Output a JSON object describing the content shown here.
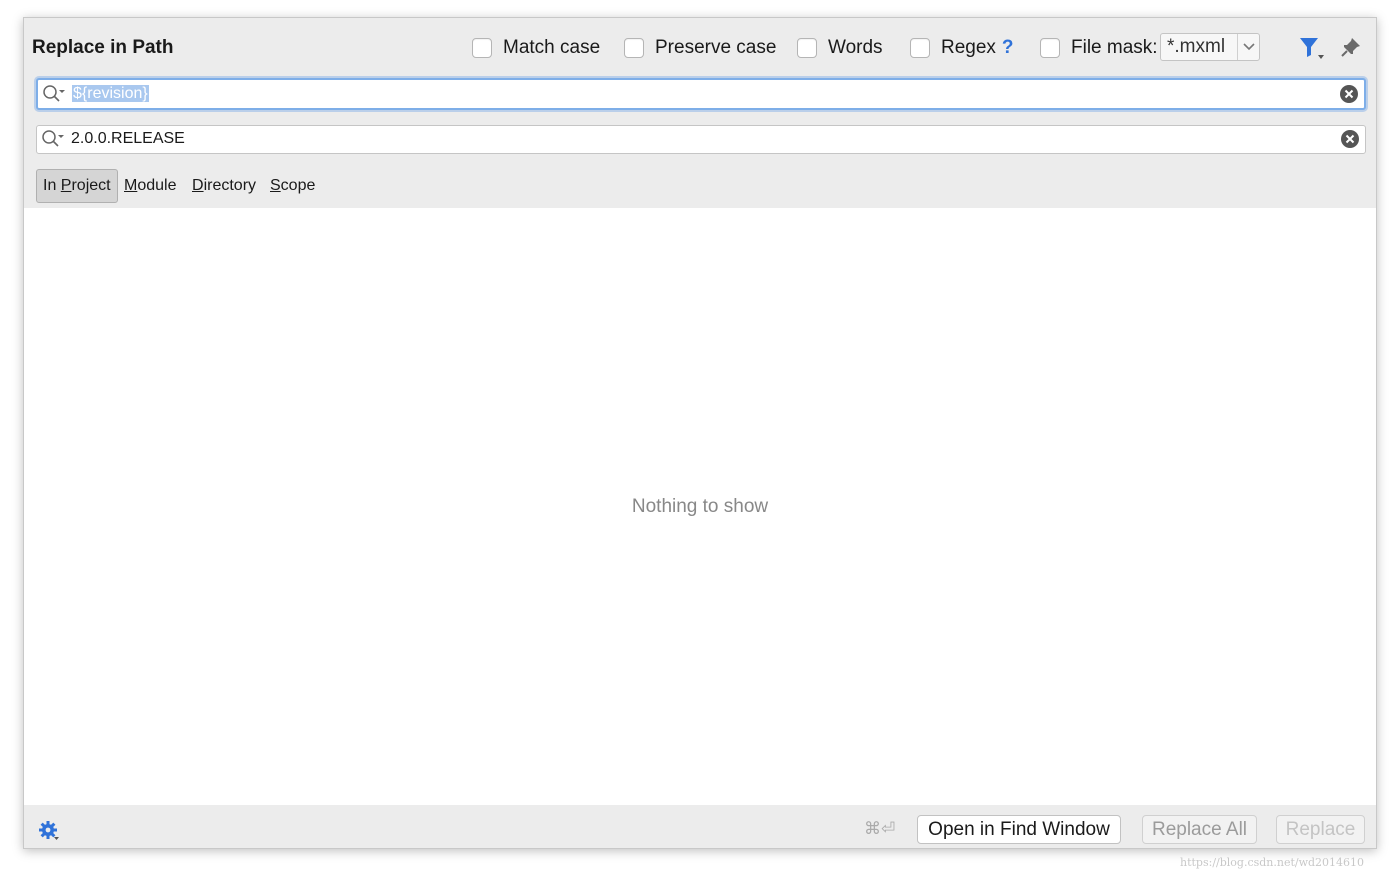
{
  "dialog": {
    "title": "Replace in Path"
  },
  "options": {
    "match_case": {
      "label": "Match case",
      "checked": false
    },
    "preserve_case": {
      "label": "Preserve case",
      "checked": false
    },
    "words": {
      "label": "Words",
      "checked": false
    },
    "regex": {
      "label": "Regex",
      "help": "?",
      "checked": false
    },
    "file_mask": {
      "label": "File mask:",
      "checked": false,
      "value": "*.mxml"
    }
  },
  "search": {
    "find_value": "${revision}",
    "replace_value": "2.0.0.RELEASE"
  },
  "scope_tabs": {
    "in_project_pre": "In ",
    "in_project_u": "P",
    "in_project_post": "roject",
    "module_u": "M",
    "module_post": "odule",
    "directory_u": "D",
    "directory_post": "irectory",
    "scope_u": "S",
    "scope_post": "cope",
    "active": "In Project"
  },
  "results": {
    "empty_text": "Nothing to show"
  },
  "footer": {
    "shortcut": "⌘⏎",
    "open_in_find_window": "Open in Find Window",
    "replace_all": "Replace All",
    "replace": "Replace"
  },
  "watermark": "https://blog.csdn.net/wd2014610",
  "colors": {
    "accent": "#2f72d9",
    "focus_ring": "#7eaee8",
    "selection": "#a9c8ef",
    "panel": "#ececec"
  },
  "icons": [
    "filter-icon",
    "pin-icon",
    "search-icon",
    "clear-icon",
    "gear-icon",
    "chevron-down-icon"
  ]
}
